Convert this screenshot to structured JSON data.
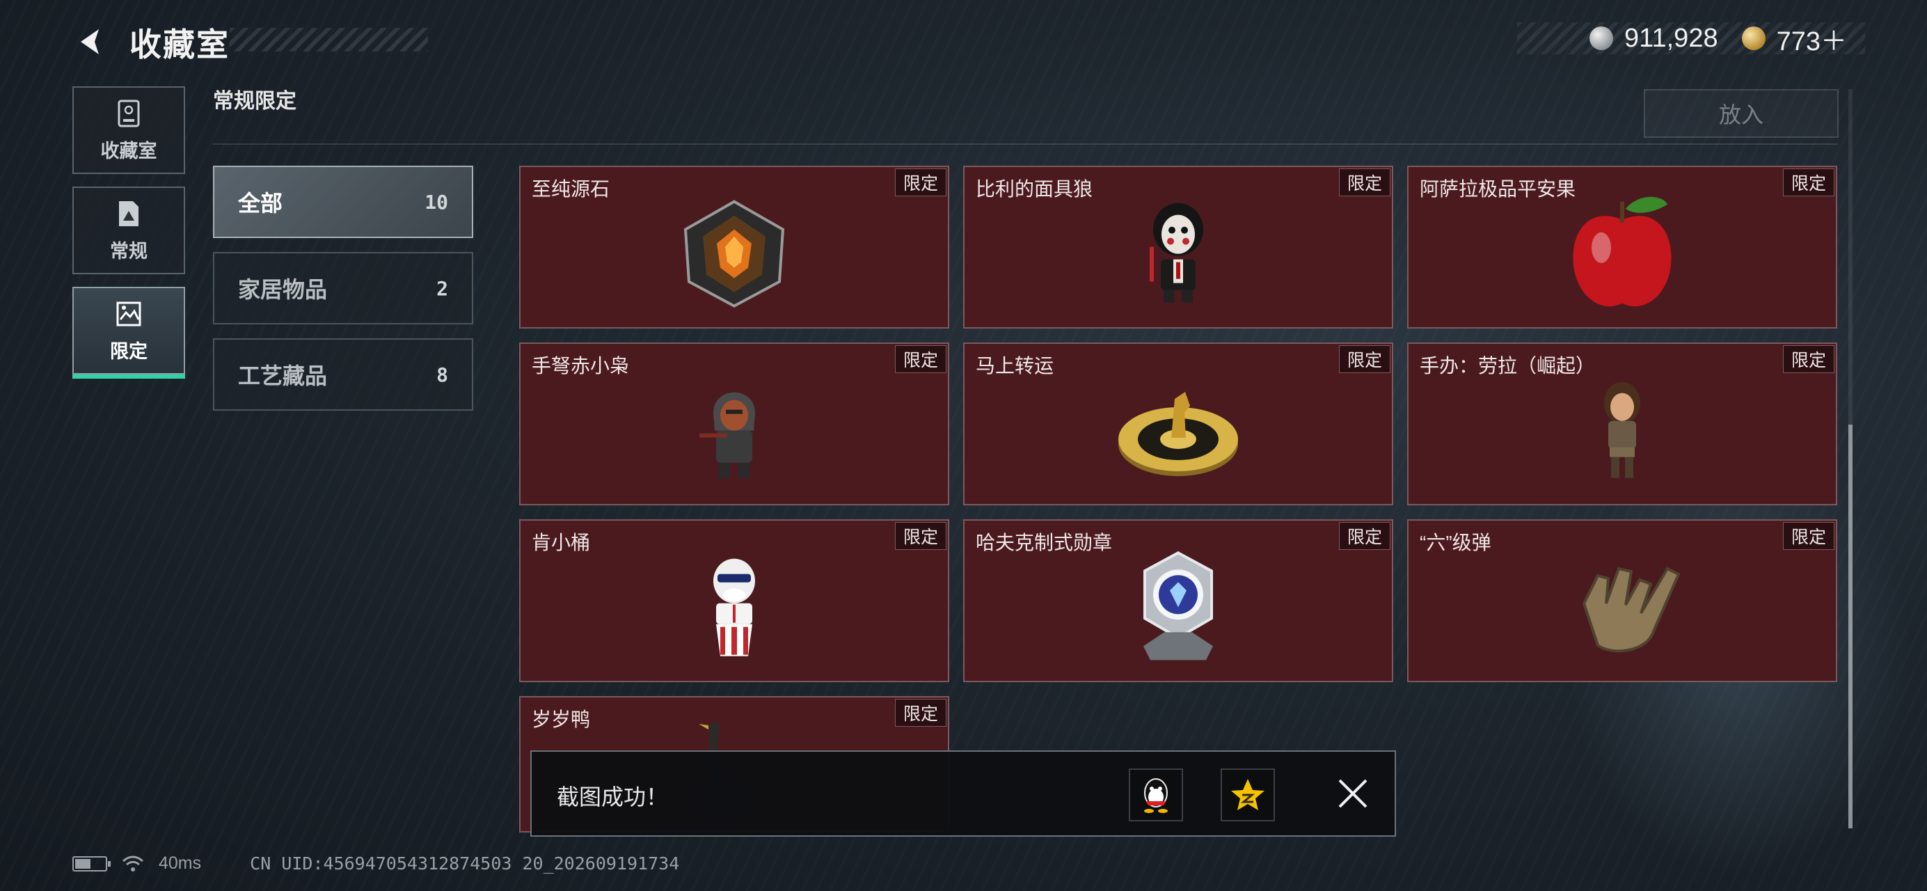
{
  "header": {
    "title": "收藏室",
    "currency": [
      {
        "icon": "silver-coin-icon",
        "value": "911,928"
      },
      {
        "icon": "gold-coin-icon",
        "value": "773＋"
      }
    ]
  },
  "nav": [
    {
      "label": "收藏室",
      "icon": "cabinet-icon",
      "active": false
    },
    {
      "label": "常规",
      "icon": "document-icon",
      "active": false
    },
    {
      "label": "限定",
      "icon": "limited-picture-icon",
      "active": true
    }
  ],
  "section": {
    "title": "常规限定",
    "put_button": "放入"
  },
  "categories": [
    {
      "label": "全部",
      "count": "10",
      "active": true
    },
    {
      "label": "家居物品",
      "count": "2",
      "active": false
    },
    {
      "label": "工艺藏品",
      "count": "8",
      "active": false
    }
  ],
  "items": [
    {
      "name": "至纯源石",
      "tag": "限定",
      "art": "crystal-stone-icon"
    },
    {
      "name": "比利的面具狼",
      "tag": "限定",
      "art": "masked-figure-icon"
    },
    {
      "name": "阿萨拉极品平安果",
      "tag": "限定",
      "art": "apple-icon"
    },
    {
      "name": "手弩赤小枭",
      "tag": "限定",
      "art": "hooded-figure-icon"
    },
    {
      "name": "马上转运",
      "tag": "限定",
      "art": "horse-wheel-icon"
    },
    {
      "name": "手办：劳拉（崛起）",
      "tag": "限定",
      "art": "lara-figure-icon"
    },
    {
      "name": "肯小桶",
      "tag": "限定",
      "art": "bucket-figure-icon"
    },
    {
      "name": "哈夫克制式勋章",
      "tag": "限定",
      "art": "medal-icon"
    },
    {
      "name": "“六”级弹",
      "tag": "限定",
      "art": "hand-sign-icon"
    },
    {
      "name": "岁岁鸭",
      "tag": "限定",
      "art": "duck-icon"
    }
  ],
  "toast": {
    "text": "截图成功！",
    "share": [
      "qq-icon",
      "qzone-star-icon"
    ],
    "close": "close-icon"
  },
  "status": {
    "ping": "40ms",
    "uid": "CN UID:456947054312874503 20_202609191734"
  }
}
